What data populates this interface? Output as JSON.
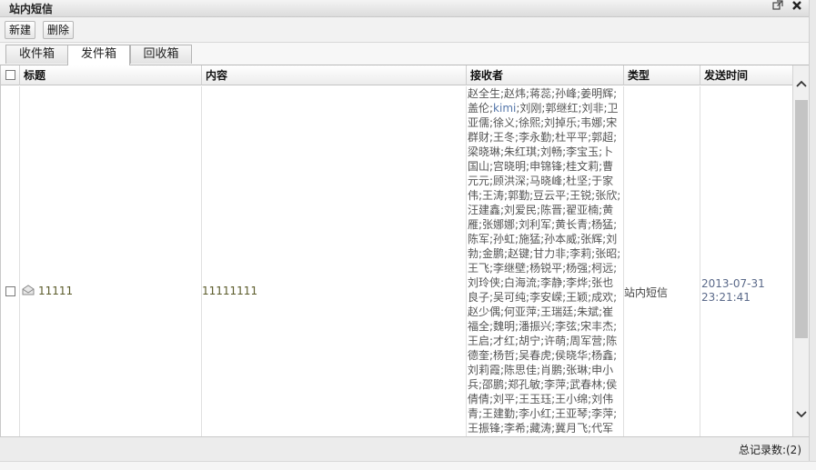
{
  "window": {
    "title": "站内短信",
    "popout_icon": "popout-icon",
    "close_icon": "close-icon"
  },
  "toolbar": {
    "new_label": "新建",
    "delete_label": "删除"
  },
  "tabs": [
    {
      "label": "收件箱",
      "active": false
    },
    {
      "label": "发件箱",
      "active": true
    },
    {
      "label": "回收箱",
      "active": false
    }
  ],
  "table": {
    "columns": [
      "标题",
      "内容",
      "接收者",
      "类型",
      "发送时间"
    ],
    "rows": [
      {
        "title": "11111",
        "content": "11111111",
        "receivers": "赵全生;赵炜;蒋蕊;孙峰;姜明辉;盖伦;kimi;刘刚;郭继红;刘非;卫亚儒;徐义;徐熙;刘掉乐;韦娜;宋群财;王冬;李永勤;杜平平;郭超;梁晓琳;朱红琪;刘畅;李宝玉;卜国山;宫晓明;申锦锋;桂文莉;曹元元;顾洪深;马晓峰;杜坚;于家伟;王涛;郭勤;豆云平;王锐;张欣;汪建鑫;刘爱民;陈晋;翟亚楠;黄雁;张娜娜;刘利军;黄长青;杨猛;陈军;孙虹;施猛;孙本威;张辉;刘勃;金鹏;赵键;甘力非;李莉;张昭;王飞;李继壁;杨锐平;杨强;柯远;刘玲侠;白海流;李静;李烨;张也良子;吴可纯;李安嵘;王颖;成欢;赵少偶;何亚萍;王瑞廷;朱斌;崔福全;魏明;潘振兴;李弦;宋丰杰;王启;才红;胡宁;许萌;周军营;陈德奎;杨哲;吴春虎;侯晓华;杨鑫;刘莉霞;陈思佳;肖鹏;张琳;申小兵;邵鹏;郑孔敏;李萍;武春林;侯倩倩;刘平;王玉珏;王小绵;刘伟青;王建勤;李小红;王亚琴;李萍;王振锋;李希;藏涛;冀月飞;代军治;杨",
        "kimi": "kimi",
        "type": "站内短信",
        "send_date": "2013-07-31",
        "send_time": "23:21:41"
      }
    ]
  },
  "footer": {
    "total_label": "总记录数:(2)"
  },
  "icons": {
    "message": "envelope-icon",
    "scroll_up": "chevron-up-icon",
    "scroll_down": "chevron-down-icon"
  }
}
